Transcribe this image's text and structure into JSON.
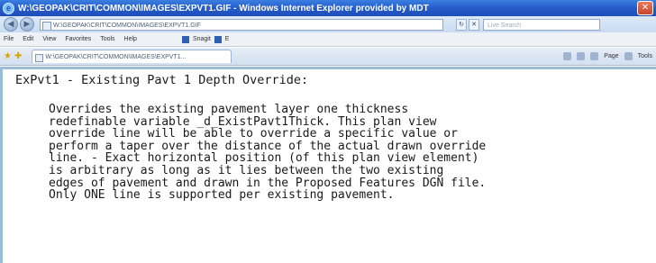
{
  "window": {
    "title": "W:\\GEOPAK\\CRIT\\COMMON\\IMAGES\\EXPVT1.GIF - Windows Internet Explorer provided by MDT",
    "close_glyph": "✕",
    "logo_glyph": "e"
  },
  "address_bar": {
    "url": "W:\\GEOPAK\\CRIT\\COMMON\\IMAGES\\EXPVT1.GIF",
    "search_placeholder": "Live Search",
    "back_glyph": "◀",
    "forward_glyph": "▶",
    "refresh_glyph": "↻",
    "stop_glyph": "✕"
  },
  "menu": {
    "items": [
      "File",
      "Edit",
      "View",
      "Favorites",
      "Tools",
      "Help"
    ],
    "favorites_links": [
      "Snagit",
      "E"
    ]
  },
  "tab_bar": {
    "tab_title": "W:\\GEOPAK\\CRIT\\COMMON\\IMAGES\\EXPVT1...",
    "commands": [
      "Page",
      "Tools"
    ]
  },
  "document": {
    "heading": "ExPvt1 - Existing Pavt 1 Depth Override:",
    "lines": [
      "Overrides the existing pavement layer one thickness",
      "redefinable variable _d_ExistPavt1Thick. This plan view",
      "override line will be able to override a specific value or",
      "perform a taper over the distance of the actual drawn override",
      "line. - Exact horizontal position (of this plan view element)",
      "is arbitrary as long as it lies between the two existing",
      "edges of pavement and drawn in the Proposed Features DGN file.",
      "Only ONE line is supported per existing pavement."
    ]
  }
}
